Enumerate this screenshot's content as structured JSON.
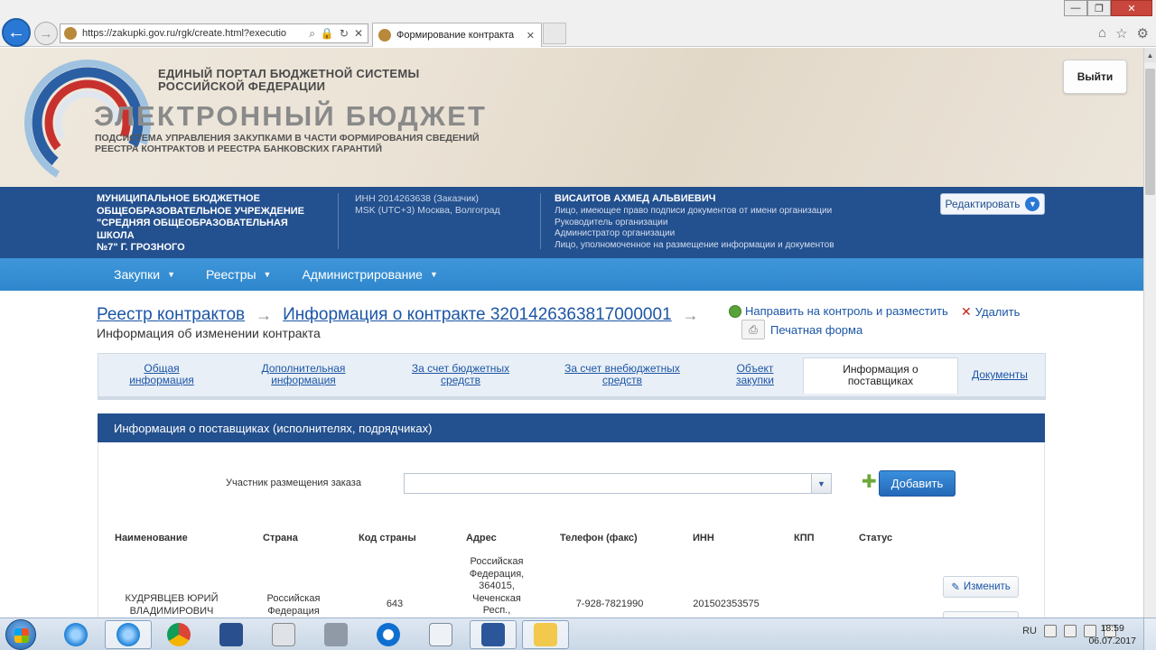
{
  "browser": {
    "url": "https://zakupki.gov.ru/rgk/create.html?executio",
    "tab_title": "Формирование контракта",
    "tab_close": "✕",
    "addr_icons": [
      "⌕",
      "🔒",
      "↻",
      "✕"
    ],
    "back_glyph": "←",
    "fwd_glyph": "→",
    "win_min": "—",
    "win_restore": "❐",
    "win_close": "✕",
    "icons": [
      "home-icon",
      "star-icon",
      "gear-icon"
    ],
    "home_glyph": "⌂",
    "star_glyph": "☆",
    "gear_glyph": "⚙"
  },
  "portal": {
    "line1": "ЕДИНЫЙ ПОРТАЛ БЮДЖЕТНОЙ СИСТЕМЫ",
    "line2": "РОССИЙСКОЙ ФЕДЕРАЦИИ",
    "title": "ЭЛЕКТРОННЫЙ БЮДЖЕТ",
    "sub1": "ПОДСИСТЕМА УПРАВЛЕНИЯ ЗАКУПКАМИ В ЧАСТИ ФОРМИРОВАНИЯ СВЕДЕНИЙ",
    "sub2": "РЕЕСТРА КОНТРАКТОВ И РЕЕСТРА БАНКОВСКИХ ГАРАНТИЙ",
    "logout": "Выйти"
  },
  "org": {
    "name_lines": [
      "МУНИЦИПАЛЬНОЕ БЮДЖЕТНОЕ",
      "ОБЩЕОБРАЗОВАТЕЛЬНОЕ УЧРЕЖДЕНИЕ",
      "\"СРЕДНЯЯ ОБЩЕОБРАЗОВАТЕЛЬНАЯ ШКОЛА",
      "№7\" Г. ГРОЗНОГО"
    ],
    "inn": "ИНН 2014263638 (Заказчик)",
    "tz": "MSK (UTC+3) Москва, Волгоград",
    "user": "ВИСАИТОВ АХМЕД АЛЬВИЕВИЧ",
    "roles": [
      "Лицо, имеющее право подписи документов от имени организации",
      "Руководитель организации",
      "Администратор организации",
      "Лицо, уполномоченное на размещение информации и документов"
    ],
    "edit": "Редактировать",
    "edit_caret": "▼"
  },
  "menu": [
    {
      "label": "Закупки",
      "caret": "▼"
    },
    {
      "label": "Реестры",
      "caret": "▼"
    },
    {
      "label": "Администрирование",
      "caret": "▼"
    }
  ],
  "breadcrumb": {
    "item1": "Реестр контрактов",
    "item2": "Информация о контракте 3201426363817000001",
    "arrow": "→",
    "subtitle": "Информация об изменении контракта"
  },
  "actions": {
    "send": "Направить на контроль и разместить",
    "delete_glyph": "✕",
    "delete": "Удалить",
    "print_glyph": "⎙",
    "print": "Печатная форма"
  },
  "tabs": [
    {
      "line1": "Общая",
      "line2": "информация"
    },
    {
      "line1": "Дополнительная",
      "line2": "информация"
    },
    {
      "line1": "За счет бюджетных",
      "line2": "средств"
    },
    {
      "line1": "За счет внебюджетных",
      "line2": "средств"
    },
    {
      "line1": "Объект",
      "line2": "закупки"
    },
    {
      "line1": "Информация о",
      "line2": "поставщиках"
    },
    {
      "line1": "Документы",
      "line2": ""
    }
  ],
  "section": {
    "title": "Информация о поставщиках (исполнителях, подрядчиках)",
    "participant_label": "Участник размещения заказа",
    "participant_value": "",
    "select_caret": "▼",
    "plus": "✚",
    "add": "Добавить"
  },
  "table": {
    "headers": [
      "Наименование",
      "Страна",
      "Код страны",
      "Адрес",
      "Телефон (факс)",
      "ИНН",
      "КПП",
      "Статус"
    ],
    "row": {
      "name": [
        "КУДРЯВЦЕВ ЮРИЙ",
        "ВЛАДИМИРОВИЧ"
      ],
      "country": [
        "Российская",
        "Федерация"
      ],
      "code": "643",
      "address": [
        "Российская",
        "Федерация,",
        "364015,",
        "Чеченская",
        "Респ.,"
      ],
      "phone": "7-928-7821990",
      "inn": "201502353575",
      "kpp": "",
      "status": ""
    },
    "edit_glyph": "✎",
    "edit": "Изменить"
  },
  "scrollbar": {
    "up_glyph": "▲"
  },
  "taskbar": {
    "apps": [
      "ie-icon",
      "ie-active-icon",
      "chrome-icon",
      "floppy-icon",
      "calculator-icon",
      "scanner-icon",
      "teamviewer-icon",
      "notepad-icon",
      "word-icon",
      "folder-icon"
    ],
    "lang": "RU",
    "time": "18:59",
    "date": "06.07.2017"
  }
}
